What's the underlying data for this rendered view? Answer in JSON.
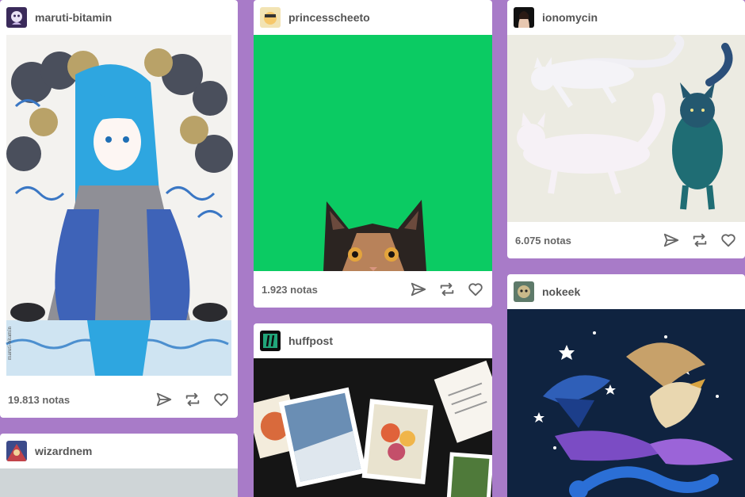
{
  "posts": [
    {
      "username": "maruti-bitamin",
      "notes": "19.813 notas",
      "watermark": "maruti-bitamin"
    },
    {
      "username": "princesscheeto",
      "notes": "1.923 notas"
    },
    {
      "username": "ionomycin",
      "notes": "6.075 notas"
    },
    {
      "username": "wizardnem"
    },
    {
      "username": "huffpost"
    },
    {
      "username": "nokeek"
    }
  ],
  "colors": {
    "dashboard_bg": "#a87bc8",
    "card_bg": "#ffffff",
    "green_screen": "#0bcb63",
    "night_sky": "#0f2340"
  },
  "icons": [
    "share-icon",
    "reblog-icon",
    "like-icon"
  ]
}
